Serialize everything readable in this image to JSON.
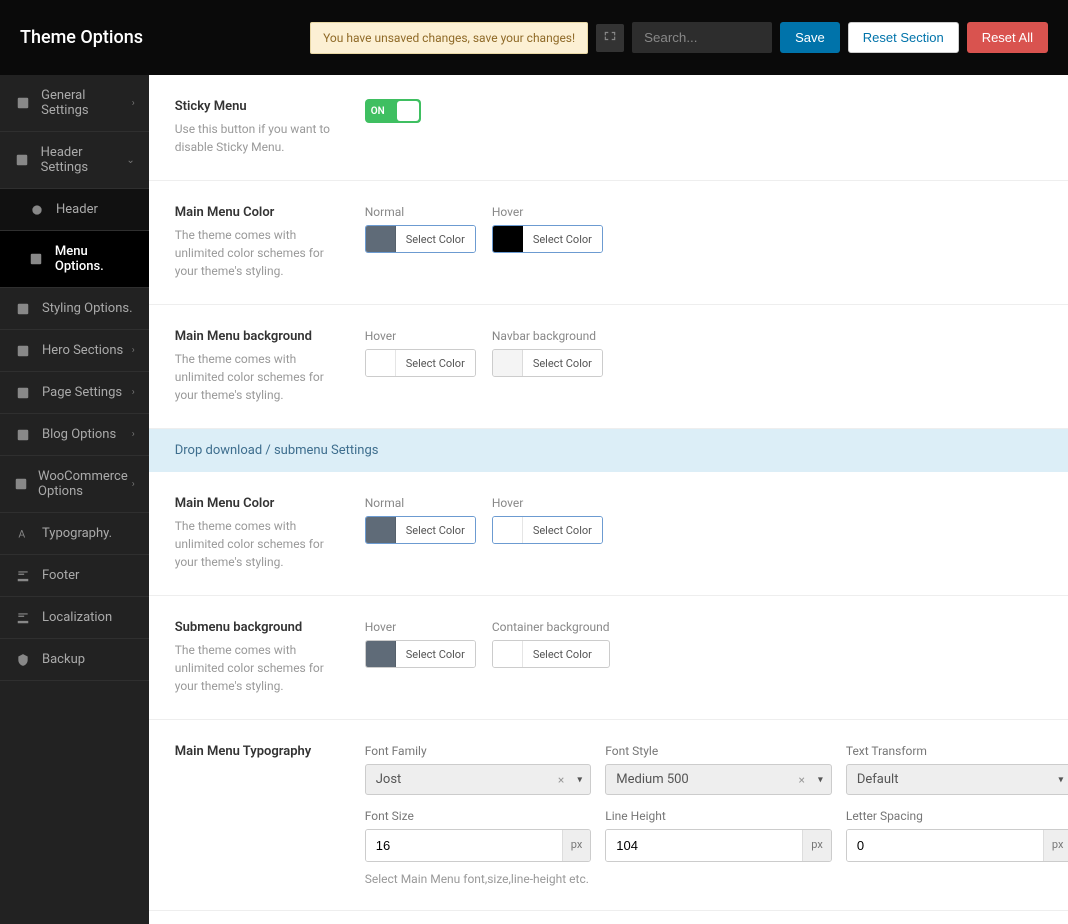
{
  "header": {
    "title": "Theme Options",
    "notice": "You have unsaved changes, save your changes!",
    "search_placeholder": "Search...",
    "save": "Save",
    "reset_section": "Reset Section",
    "reset_all": "Reset All"
  },
  "sidebar": {
    "items": [
      {
        "label": "General Settings",
        "arrow": "›"
      },
      {
        "label": "Header Settings",
        "arrow": "⌄"
      }
    ],
    "sub": [
      {
        "label": "Header"
      },
      {
        "label": "Menu Options."
      }
    ],
    "items2": [
      {
        "label": "Styling Options."
      },
      {
        "label": "Hero Sections",
        "arrow": "›"
      },
      {
        "label": "Page Settings",
        "arrow": "›"
      },
      {
        "label": "Blog Options",
        "arrow": "›"
      },
      {
        "label": "WooCommerce Options",
        "arrow": "›"
      },
      {
        "label": "Typography."
      },
      {
        "label": "Footer"
      },
      {
        "label": "Localization"
      },
      {
        "label": "Backup"
      }
    ]
  },
  "sections": {
    "sticky": {
      "title": "Sticky Menu",
      "desc": "Use this button if you want to disable Sticky Menu.",
      "toggle": "ON"
    },
    "main_color": {
      "title": "Main Menu Color",
      "desc": "The theme comes with unlimited color schemes for your theme's styling.",
      "f1": "Normal",
      "f2": "Hover",
      "btn": "Select Color"
    },
    "main_bg": {
      "title": "Main Menu background",
      "desc": "The theme comes with unlimited color schemes for your theme's styling.",
      "f1": "Hover",
      "f2": "Navbar background",
      "btn": "Select Color"
    },
    "divider": "Drop download / submenu Settings",
    "sub_color": {
      "title": "Main Menu Color",
      "desc": "The theme comes with unlimited color schemes for your theme's styling.",
      "f1": "Normal",
      "f2": "Hover",
      "btn": "Select Color"
    },
    "sub_bg": {
      "title": "Submenu background",
      "desc": "The theme comes with unlimited color schemes for your theme's styling.",
      "f1": "Hover",
      "f2": "Container background",
      "btn": "Select Color"
    },
    "typo": {
      "title": "Main Menu Typography",
      "font_family_label": "Font Family",
      "font_family": "Jost",
      "font_style_label": "Font Style",
      "font_style": "Medium 500",
      "text_transform_label": "Text Transform",
      "text_transform": "Default",
      "font_size_label": "Font Size",
      "font_size": "16",
      "line_height_label": "Line Height",
      "line_height": "104",
      "letter_spacing_label": "Letter Spacing",
      "letter_spacing": "0",
      "unit": "px",
      "desc": "Select Main Menu font,size,line-height etc."
    }
  }
}
